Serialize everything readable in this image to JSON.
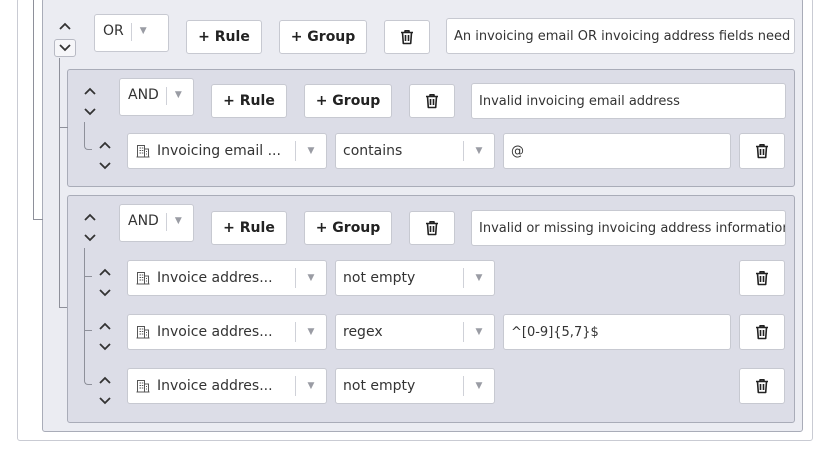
{
  "root": {
    "combinator": "OR",
    "add_rule_label": "+ Rule",
    "add_group_label": "+ Group",
    "description": "An invoicing email OR invoicing address fields need to be valid"
  },
  "groups": [
    {
      "combinator": "AND",
      "add_rule_label": "+ Rule",
      "add_group_label": "+ Group",
      "description": "Invalid invoicing email address",
      "rules": [
        {
          "field": "Invoicing email ...",
          "operator": "contains",
          "value": "@"
        }
      ]
    },
    {
      "combinator": "AND",
      "add_rule_label": "+ Rule",
      "add_group_label": "+ Group",
      "description": "Invalid or missing invoicing address information",
      "rules": [
        {
          "field": "Invoice addres...",
          "operator": "not empty",
          "value": ""
        },
        {
          "field": "Invoice addres...",
          "operator": "regex",
          "value": "^[0-9]{5,7}$"
        },
        {
          "field": "Invoice addres...",
          "operator": "not empty",
          "value": ""
        }
      ]
    }
  ],
  "icons": {
    "move_up": "chevron-up-icon",
    "move_down": "chevron-down-icon",
    "delete": "trash-icon",
    "field": "building-icon",
    "dropdown": "caret-down-icon"
  }
}
